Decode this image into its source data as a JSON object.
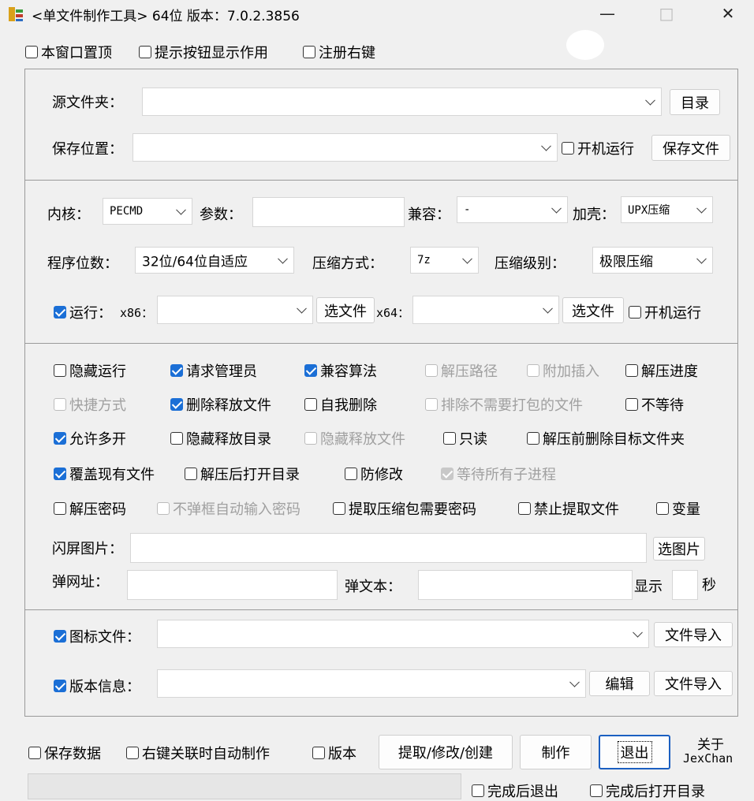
{
  "window": {
    "title": "<单文件制作工具> 64位 版本：7.0.2.3856",
    "minimize": "—",
    "maximize": "□",
    "close": "✕"
  },
  "top_options": [
    {
      "label": "本窗口置顶",
      "checked": false
    },
    {
      "label": "提示按钮显示作用",
      "checked": false
    },
    {
      "label": "注册右键",
      "checked": false
    }
  ],
  "source": {
    "label": "源文件夹：",
    "value": "",
    "dir_button": "目录"
  },
  "save": {
    "label": "保存位置：",
    "value": "",
    "autorun_label": "开机运行",
    "autorun_checked": false,
    "save_button": "保存文件"
  },
  "core": {
    "kernel_label": "内核：",
    "kernel_value": "PECMD",
    "params_label": "参数：",
    "params_value": "",
    "compat_label": "兼容：",
    "compat_value": "-",
    "shell_label": "加壳：",
    "shell_value": "UPX压缩",
    "bits_label": "程序位数：",
    "bits_value": "32位/64位自适应",
    "method_label": "压缩方式：",
    "method_value": "7z",
    "level_label": "压缩级别：",
    "level_value": "极限压缩",
    "run_label": "运行：",
    "run_checked": true,
    "x86_label": "x86：",
    "x86_value": "",
    "x86_button": "选文件",
    "x64_label": "x64：",
    "x64_value": "",
    "x64_button": "选文件",
    "run_autorun_label": "开机运行",
    "run_autorun_checked": false
  },
  "options": {
    "r1": [
      {
        "label": "隐藏运行",
        "checked": false,
        "disabled": false
      },
      {
        "label": "请求管理员",
        "checked": true,
        "disabled": false
      },
      {
        "label": "兼容算法",
        "checked": true,
        "disabled": false
      },
      {
        "label": "解压路径",
        "checked": false,
        "disabled": true
      },
      {
        "label": "附加插入",
        "checked": false,
        "disabled": true
      },
      {
        "label": "解压进度",
        "checked": false,
        "disabled": false
      }
    ],
    "r2": [
      {
        "label": "快捷方式",
        "checked": false,
        "disabled": true
      },
      {
        "label": "删除释放文件",
        "checked": true,
        "disabled": false
      },
      {
        "label": "自我删除",
        "checked": false,
        "disabled": false
      },
      {
        "label": "排除不需要打包的文件",
        "checked": false,
        "disabled": true
      },
      {
        "label": "不等待",
        "checked": false,
        "disabled": false
      }
    ],
    "r3": [
      {
        "label": "允许多开",
        "checked": true,
        "disabled": false
      },
      {
        "label": "隐藏释放目录",
        "checked": false,
        "disabled": false
      },
      {
        "label": "隐藏释放文件",
        "checked": false,
        "disabled": true
      },
      {
        "label": "只读",
        "checked": false,
        "disabled": false
      },
      {
        "label": "解压前删除目标文件夹",
        "checked": false,
        "disabled": false
      }
    ],
    "r4": [
      {
        "label": "覆盖现有文件",
        "checked": true,
        "disabled": false
      },
      {
        "label": "解压后打开目录",
        "checked": false,
        "disabled": false
      },
      {
        "label": "防修改",
        "checked": false,
        "disabled": false
      },
      {
        "label": "等待所有子进程",
        "checked": true,
        "disabled": true
      }
    ],
    "r5": [
      {
        "label": "解压密码",
        "checked": false,
        "disabled": false
      },
      {
        "label": "不弹框自动输入密码",
        "checked": false,
        "disabled": true
      },
      {
        "label": "提取压缩包需要密码",
        "checked": false,
        "disabled": false
      },
      {
        "label": "禁止提取文件",
        "checked": false,
        "disabled": false
      },
      {
        "label": "变量",
        "checked": false,
        "disabled": false
      }
    ],
    "splash_label": "闪屏图片：",
    "splash_value": "",
    "splash_button": "选图片",
    "popurl_label": "弹网址：",
    "popurl_value": "",
    "poptext_label": "弹文本：",
    "poptext_value": "",
    "show_label": "显示",
    "show_value": "",
    "seconds_label": "秒"
  },
  "resources": {
    "icon_label": "图标文件：",
    "icon_checked": true,
    "icon_value": "",
    "icon_import": "文件导入",
    "version_label": "版本信息：",
    "version_checked": true,
    "version_value": "",
    "edit_button": "编辑",
    "version_import": "文件导入"
  },
  "bottom": {
    "save_data_label": "保存数据",
    "save_data_checked": false,
    "auto_make_label": "右键关联时自动制作",
    "auto_make_checked": false,
    "version_label": "版本",
    "version_checked": false,
    "extract_button": "提取/修改/创建",
    "make_button": "制作",
    "exit_button": "退出",
    "about_line1": "关于",
    "about_line2": "JexChan",
    "exit_after_label": "完成后退出",
    "exit_after_checked": false,
    "open_dir_label": "完成后打开目录",
    "open_dir_checked": false
  }
}
